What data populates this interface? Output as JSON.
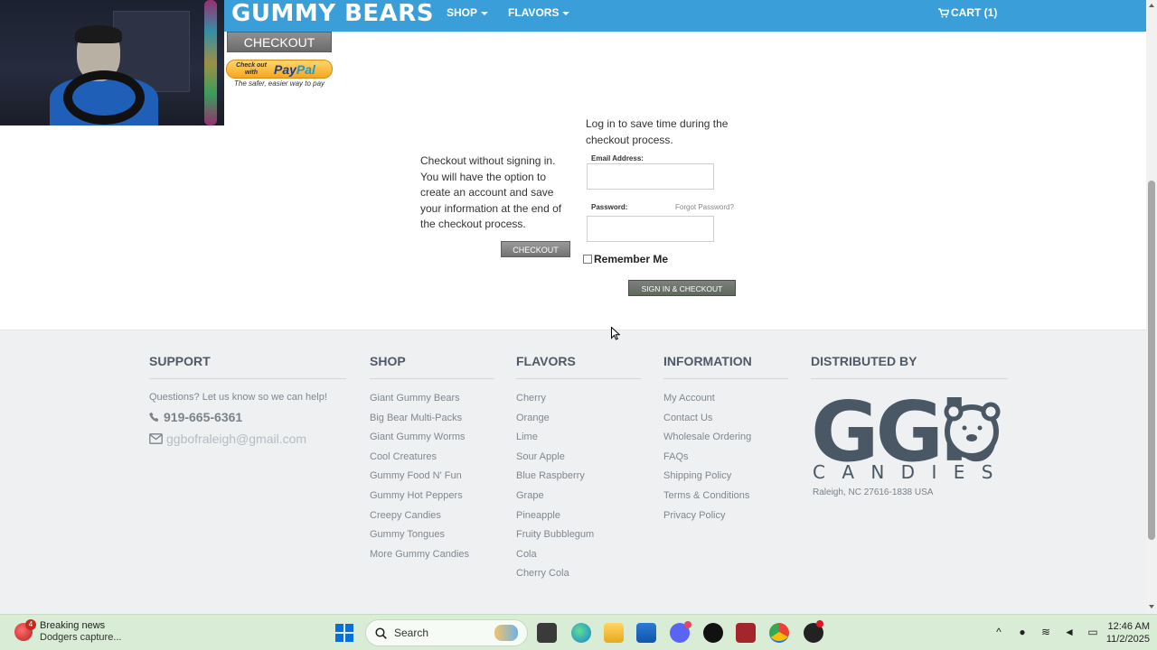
{
  "nav": {
    "brand": "GUMMY BEARS",
    "shop": "SHOP",
    "flavors": "FLAVORS",
    "cart": "CART (1)"
  },
  "checkout_top": {
    "button": "CHECKOUT",
    "paypal_small": "Check out with",
    "paypal_logo_pay": "Pay",
    "paypal_logo_pal": "Pal",
    "paypal_tagline": "The safer, easier way to pay"
  },
  "guest": {
    "text": "Checkout without signing in. You will have the option to create an account and save your information at the end of the checkout process.",
    "button": "CHECKOUT"
  },
  "login": {
    "intro": "Log in to save time during the checkout process.",
    "email_label": "Email Address:",
    "email_value": "",
    "password_label": "Password:",
    "password_value": "",
    "forgot": "Forgot Password?",
    "remember": "Remember Me",
    "remember_checked": false,
    "signin_button": "SIGN IN & CHECKOUT"
  },
  "footer": {
    "support": {
      "heading": "SUPPORT",
      "question": "Questions? Let us know so we can help!",
      "phone": "919-665-6361",
      "email": "ggbofraleigh@gmail.com"
    },
    "shop": {
      "heading": "SHOP",
      "items": [
        "Giant Gummy Bears",
        "Big Bear Multi-Packs",
        "Giant Gummy Worms",
        "Cool Creatures",
        "Gummy Food N' Fun",
        "Gummy Hot Peppers",
        "Creepy Candies",
        "Gummy Tongues",
        "More Gummy Candies"
      ]
    },
    "flavors": {
      "heading": "FLAVORS",
      "items": [
        "Cherry",
        "Orange",
        "Lime",
        "Sour Apple",
        "Blue Raspberry",
        "Grape",
        "Pineapple",
        "Fruity Bubblegum",
        "Cola",
        "Cherry Cola"
      ]
    },
    "information": {
      "heading": "INFORMATION",
      "items": [
        "My Account",
        "Contact Us",
        "Wholesale Ordering",
        "FAQs",
        "Shipping Policy",
        "Terms & Conditions",
        "Privacy Policy"
      ]
    },
    "distributed": {
      "heading": "DISTRIBUTED BY",
      "logo_letters": "GGb",
      "logo_sub": "C A N D I E S",
      "address": "Raleigh, NC 27616-1838 USA"
    }
  },
  "taskbar": {
    "news_badge": "4",
    "news_title": "Breaking news",
    "news_sub": "Dodgers capture...",
    "search": "Search",
    "time": "12:46 AM",
    "date": "11/2/2025"
  },
  "colors": {
    "nav_bg": "#3a9fd8",
    "footer_bg": "#eef0f2",
    "footer_heading": "#4f5a66",
    "logo": "#4a5866"
  }
}
